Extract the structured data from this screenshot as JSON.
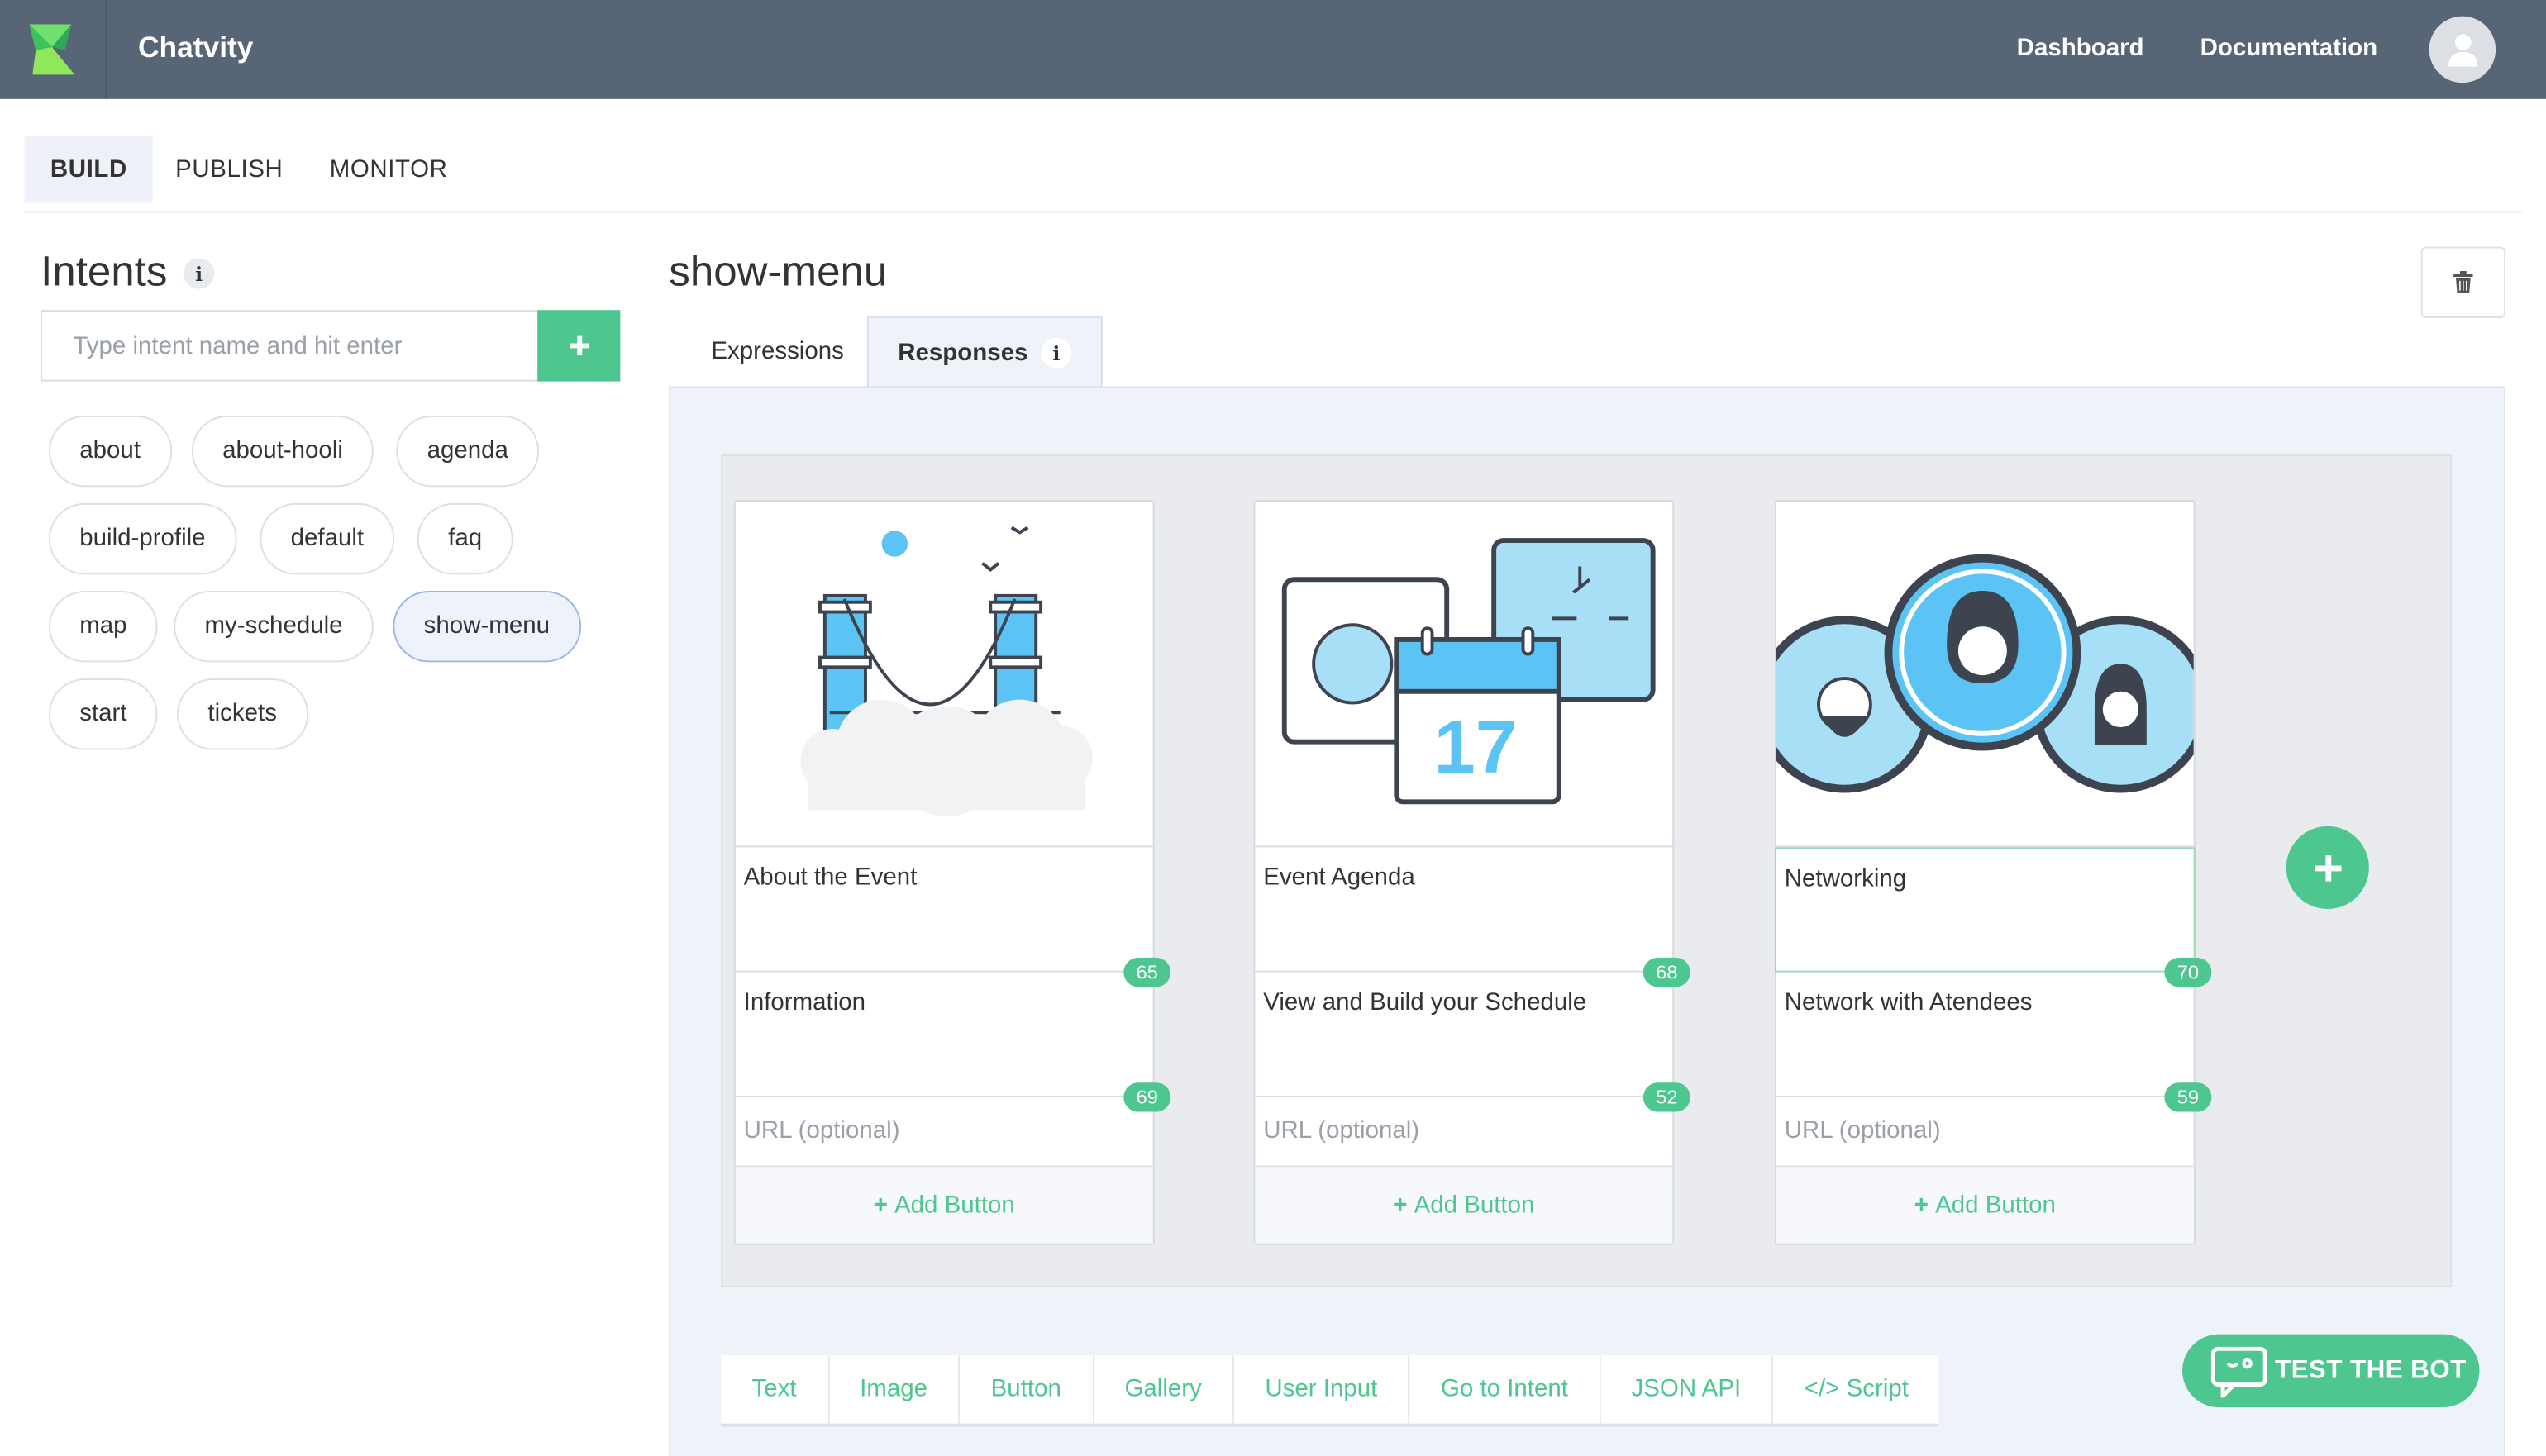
{
  "header": {
    "brand": "Chatvity",
    "links": {
      "dashboard": "Dashboard",
      "documentation": "Documentation"
    }
  },
  "main_tabs": {
    "build": "BUILD",
    "publish": "PUBLISH",
    "monitor": "MONITOR"
  },
  "intents": {
    "title": "Intents",
    "info": "i",
    "placeholder": "Type intent name and hit enter",
    "items": [
      "about",
      "about-hooli",
      "agenda",
      "build-profile",
      "default",
      "faq",
      "map",
      "my-schedule",
      "show-menu",
      "start",
      "tickets"
    ],
    "selected": "show-menu"
  },
  "intent": {
    "title": "show-menu",
    "tabs": {
      "expressions": "Expressions",
      "responses": "Responses"
    },
    "info": "i"
  },
  "gallery": {
    "cards": [
      {
        "image": "golden-gate-bridge-illustration",
        "title": "About the Event",
        "title_count": "65",
        "subtitle": "Information",
        "subtitle_count": "69",
        "url_placeholder": "URL (optional)",
        "add_button": "Add Button"
      },
      {
        "image": "calendar-agenda-illustration",
        "title": "Event Agenda",
        "title_count": "68",
        "subtitle": "View and Build your Schedule",
        "subtitle_count": "52",
        "url_placeholder": "URL (optional)",
        "add_button": "Add Button"
      },
      {
        "image": "people-avatars-illustration",
        "title": "Networking",
        "title_count": "70",
        "subtitle": "Network with Atendees",
        "subtitle_count": "59",
        "url_placeholder": "URL (optional)",
        "add_button": "Add Button"
      }
    ]
  },
  "response_types": [
    "Text",
    "Image",
    "Button",
    "Gallery",
    "User Input",
    "Go to Intent",
    "JSON API",
    "Script"
  ],
  "test_bot": "TEST THE BOT",
  "colors": {
    "header": "#576577",
    "accent": "#4dc690",
    "panel": "#eef2f9",
    "illustration_blue": "#5bc4f5"
  }
}
